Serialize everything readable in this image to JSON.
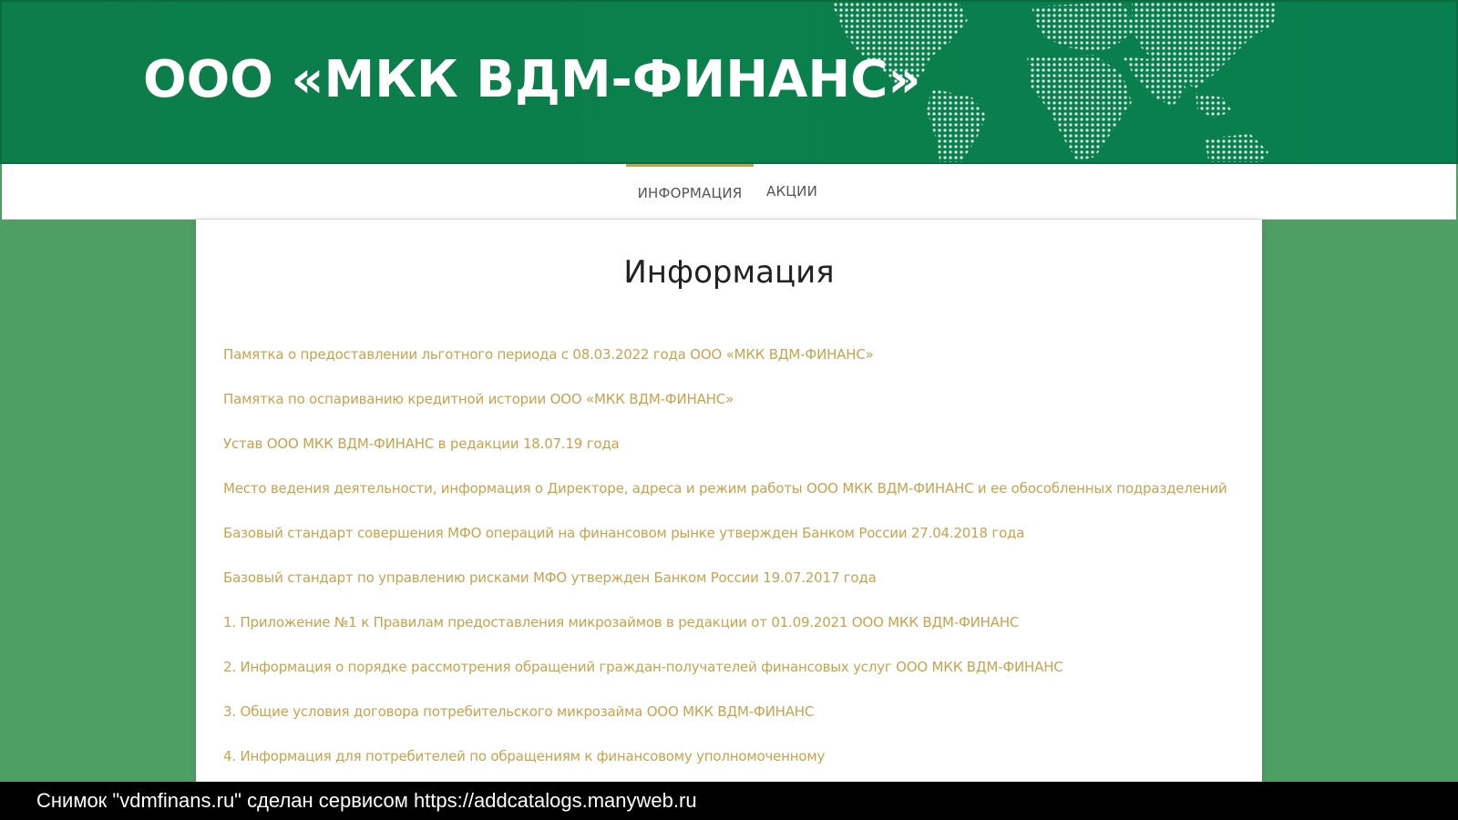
{
  "header": {
    "brand": "ООО «МКК ВДМ-ФИНАНС»"
  },
  "nav": {
    "items": [
      {
        "label": "ИНФОРМАЦИЯ",
        "active": true
      },
      {
        "label": "АКЦИИ",
        "active": false
      }
    ]
  },
  "main": {
    "title": "Информация",
    "links": [
      "Памятка о предоставлении льготного периода с 08.03.2022 года ООО «МКК ВДМ-ФИНАНС»",
      "Памятка по оспариванию кредитной истории ООО «МКК ВДМ-ФИНАНС»",
      "Устав ООО МКК ВДМ-ФИНАНС в редакции 18.07.19 года",
      "Место ведения деятельности, информация о Директоре, адреса и режим работы ООО МКК ВДМ-ФИНАНС и ее обособленных подразделений",
      "Базовый стандарт совершения МФО операций на финансовом рынке утвержден Банком России 27.04.2018 года",
      "Базовый стандарт по управлению рисками МФО утвержден Банком России 19.07.2017 года",
      "1. Приложение №1 к Правилам предоставления микрозаймов в редакции от 01.09.2021 ООО МКК ВДМ-ФИНАНС",
      "2. Информация о порядке рассмотрения обращений граждан-получателей финансовых услуг ООО МКК ВДМ-ФИНАНС",
      "3. Общие условия договора потребительского микрозайма ООО МКК ВДМ-ФИНАНС",
      "4. Информация для потребителей по обращениям к финансовому уполномоченному"
    ]
  },
  "watermark": {
    "text": "Снимок \"vdmfinans.ru\" сделан сервисом https://addcatalogs.manyweb.ru"
  },
  "colors": {
    "banner_green": "#0b7f4c",
    "background_green": "#4f9e63",
    "link_gold": "#c9a24d",
    "nav_active_border": "#c8a04a"
  },
  "icons": {
    "map": "world-map-dots-icon"
  }
}
